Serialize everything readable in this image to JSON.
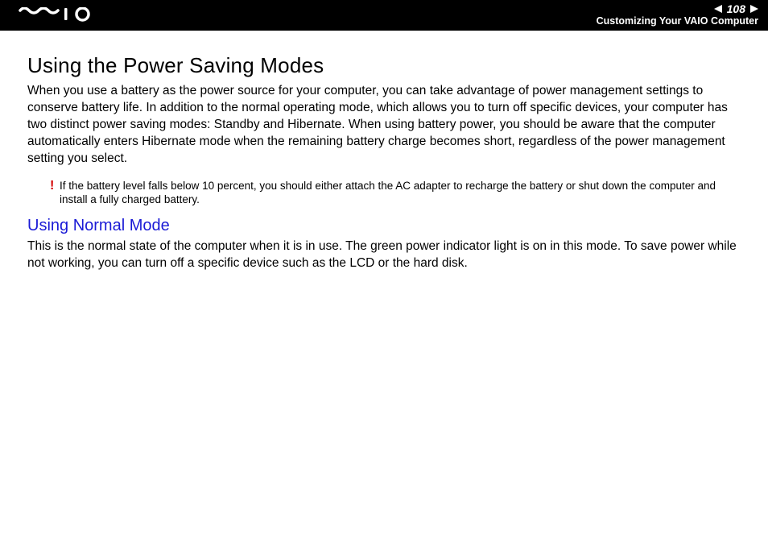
{
  "header": {
    "logo_label": "VAIO",
    "page_number": "108",
    "section": "Customizing Your VAIO Computer"
  },
  "main": {
    "title": "Using the Power Saving Modes",
    "intro": "When you use a battery as the power source for your computer, you can take advantage of power management settings to conserve battery life. In addition to the normal operating mode, which allows you to turn off specific devices, your computer has two distinct power saving modes: Standby and Hibernate. When using battery power, you should be aware that the computer automatically enters Hibernate mode when the remaining battery charge becomes short, regardless of the power management setting you select.",
    "note_symbol": "!",
    "note_text": "If the battery level falls below 10 percent, you should either attach the AC adapter to recharge the battery or shut down the computer and install a fully charged battery.",
    "subheading": "Using Normal Mode",
    "subbody": "This is the normal state of the computer when it is in use. The green power indicator light is on in this mode. To save power while not working, you can turn off a specific device such as the LCD or the hard disk."
  }
}
